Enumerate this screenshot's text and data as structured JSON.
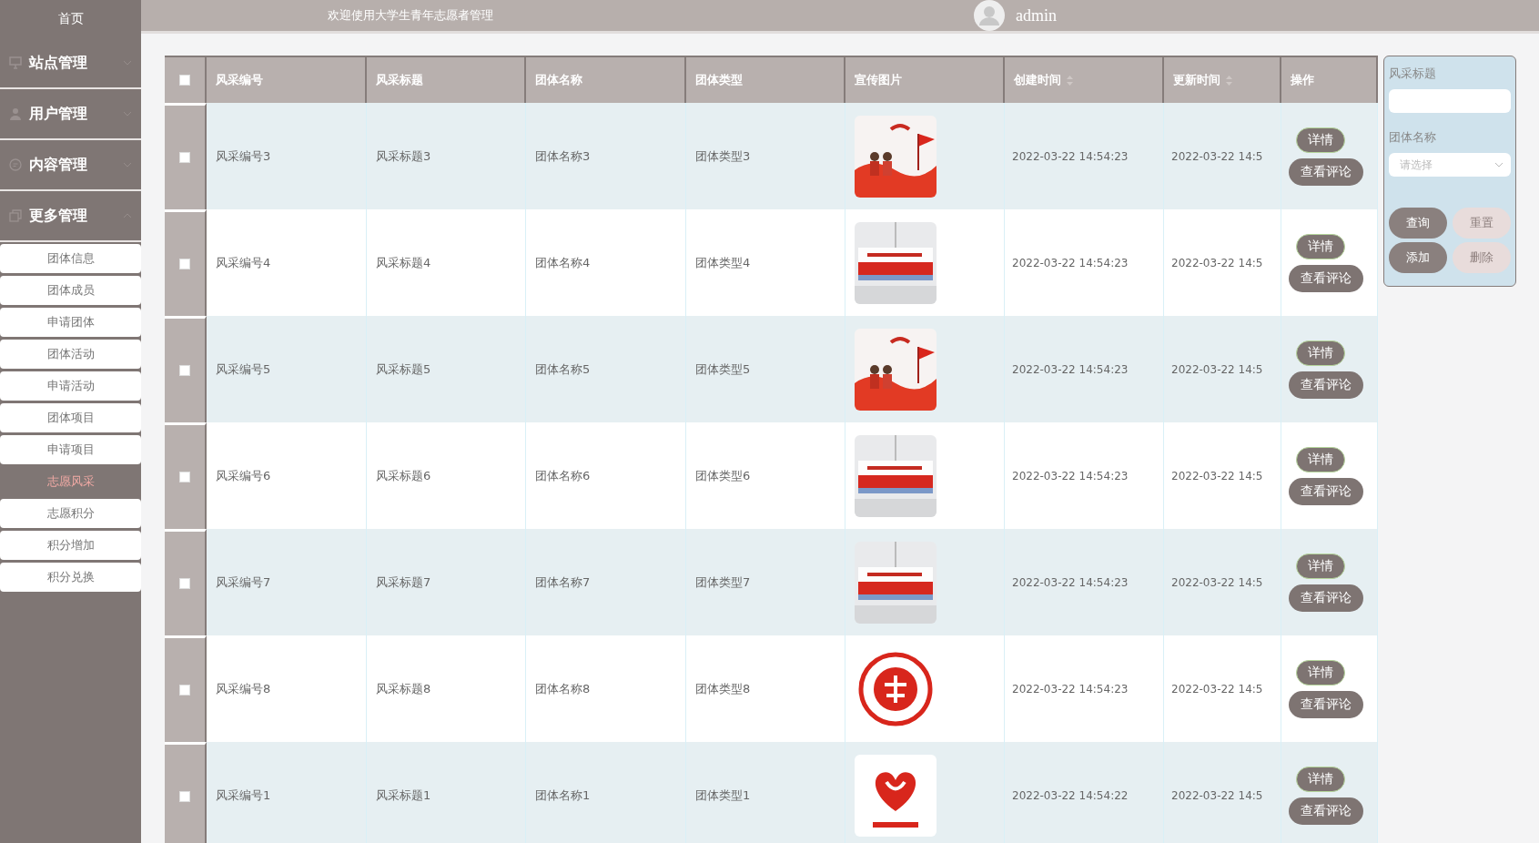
{
  "header": {
    "welcome": "欢迎使用大学生青年志愿者管理",
    "user": "admin"
  },
  "sidebar": {
    "home": "首页",
    "menus": [
      {
        "label": "站点管理",
        "expanded": false
      },
      {
        "label": "用户管理",
        "expanded": false
      },
      {
        "label": "内容管理",
        "expanded": false
      },
      {
        "label": "更多管理",
        "expanded": true,
        "children": [
          {
            "label": "团体信息",
            "selected": false
          },
          {
            "label": "团体成员",
            "selected": false
          },
          {
            "label": "申请团体",
            "selected": false
          },
          {
            "label": "团体活动",
            "selected": false
          },
          {
            "label": "申请活动",
            "selected": false
          },
          {
            "label": "团体项目",
            "selected": false
          },
          {
            "label": "申请项目",
            "selected": false
          },
          {
            "label": "志愿风采",
            "selected": true
          },
          {
            "label": "志愿积分",
            "selected": false
          },
          {
            "label": "积分增加",
            "selected": false
          },
          {
            "label": "积分兑换",
            "selected": false
          }
        ]
      }
    ]
  },
  "table": {
    "select_all": {
      "checked": false
    },
    "columns": [
      {
        "label": "风采编号",
        "sortable": false
      },
      {
        "label": "风采标题",
        "sortable": false
      },
      {
        "label": "团体名称",
        "sortable": false
      },
      {
        "label": "团体类型",
        "sortable": false
      },
      {
        "label": "宣传图片",
        "sortable": false
      },
      {
        "label": "创建时间",
        "sortable": true
      },
      {
        "label": "更新时间",
        "sortable": true
      },
      {
        "label": "操作",
        "sortable": false
      }
    ],
    "rows": [
      {
        "checked": false,
        "number": "风采编号3",
        "title": "风采标题3",
        "group": "团体名称3",
        "type": "团体类型3",
        "created": "2022-03-22 14:54:23",
        "updated": "2022-03-22 14:5",
        "actions": [
          "详情",
          "查看评论"
        ]
      },
      {
        "checked": false,
        "number": "风采编号4",
        "title": "风采标题4",
        "group": "团体名称4",
        "type": "团体类型4",
        "created": "2022-03-22 14:54:23",
        "updated": "2022-03-22 14:5",
        "actions": [
          "详情",
          "查看评论"
        ]
      },
      {
        "checked": false,
        "number": "风采编号5",
        "title": "风采标题5",
        "group": "团体名称5",
        "type": "团体类型5",
        "created": "2022-03-22 14:54:23",
        "updated": "2022-03-22 14:5",
        "actions": [
          "详情",
          "查看评论"
        ]
      },
      {
        "checked": false,
        "number": "风采编号6",
        "title": "风采标题6",
        "group": "团体名称6",
        "type": "团体类型6",
        "created": "2022-03-22 14:54:23",
        "updated": "2022-03-22 14:5",
        "actions": [
          "详情",
          "查看评论"
        ]
      },
      {
        "checked": false,
        "number": "风采编号7",
        "title": "风采标题7",
        "group": "团体名称7",
        "type": "团体类型7",
        "created": "2022-03-22 14:54:23",
        "updated": "2022-03-22 14:5",
        "actions": [
          "详情",
          "查看评论"
        ]
      },
      {
        "checked": false,
        "number": "风采编号8",
        "title": "风采标题8",
        "group": "团体名称8",
        "type": "团体类型8",
        "created": "2022-03-22 14:54:23",
        "updated": "2022-03-22 14:5",
        "actions": [
          "详情",
          "查看评论"
        ]
      },
      {
        "checked": false,
        "number": "风采编号1",
        "title": "风采标题1",
        "group": "团体名称1",
        "type": "团体类型1",
        "created": "2022-03-22 14:54:22",
        "updated": "2022-03-22 14:5",
        "actions": [
          "详情",
          "查看评论"
        ]
      }
    ]
  },
  "filter": {
    "fields": [
      {
        "label": "风采标题",
        "kind": "text"
      },
      {
        "label": "团体名称",
        "kind": "select",
        "placeholder": "请选择"
      }
    ],
    "buttons": [
      {
        "label": "查询",
        "kind": "primary"
      },
      {
        "label": "重置",
        "kind": "light"
      },
      {
        "label": "添加",
        "kind": "primary"
      },
      {
        "label": "删除",
        "kind": "light"
      }
    ]
  }
}
